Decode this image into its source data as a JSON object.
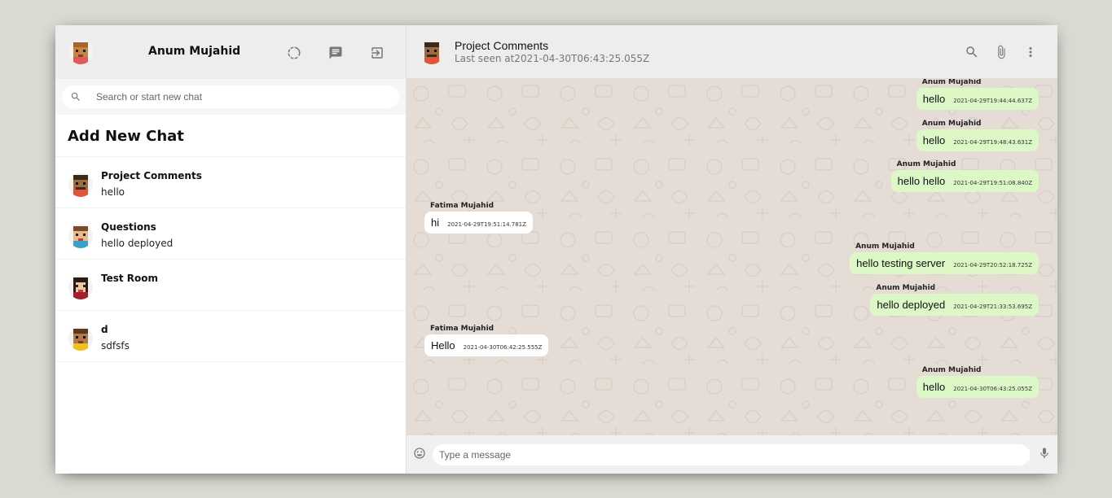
{
  "sidebar": {
    "user_name": "Anum Mujahid",
    "icons": [
      "status-icon",
      "chat-icon",
      "logout-icon"
    ],
    "search": {
      "placeholder": "Search or start new chat",
      "value": ""
    },
    "add_new_chat": "Add New Chat",
    "rooms": [
      {
        "name": "Project Comments",
        "last_message": "hello"
      },
      {
        "name": "Questions",
        "last_message": "hello deployed"
      },
      {
        "name": "Test Room",
        "last_message": ""
      },
      {
        "name": "d",
        "last_message": "sdfsfs"
      }
    ]
  },
  "chat": {
    "room_name": "Project Comments",
    "last_seen": "Last seen at2021-04-30T06:43:25.055Z",
    "icons": [
      "search-icon",
      "attach-icon",
      "more-vert-icon"
    ],
    "messages": [
      {
        "name": "Anum Mujahid",
        "text": "hello",
        "time": "2021-04-29T19:44:44.637Z",
        "sent": true
      },
      {
        "name": "Anum Mujahid",
        "text": "hello",
        "time": "2021-04-29T19:48:43.631Z",
        "sent": true
      },
      {
        "name": "Anum Mujahid",
        "text": "hello hello",
        "time": "2021-04-29T19:51:08.840Z",
        "sent": true
      },
      {
        "name": "Fatima Mujahid",
        "text": "hi",
        "time": "2021-04-29T19:51:14.781Z",
        "sent": false
      },
      {
        "name": "Anum Mujahid",
        "text": "hello testing server",
        "time": "2021-04-29T20:52:18.725Z",
        "sent": true
      },
      {
        "name": "Anum Mujahid",
        "text": "hello deployed",
        "time": "2021-04-29T21:33:53.695Z",
        "sent": true
      },
      {
        "name": "Fatima Mujahid",
        "text": "Hello",
        "time": "2021-04-30T06:42:25.555Z",
        "sent": false
      },
      {
        "name": "Anum Mujahid",
        "text": "hello",
        "time": "2021-04-30T06:43:25.055Z",
        "sent": true
      }
    ],
    "input": {
      "placeholder": "Type a message",
      "value": ""
    }
  },
  "colors": {
    "background": "#dadbd3",
    "header": "#ededed",
    "sent_bubble": "#dcf8c6",
    "received_bubble": "#ffffff",
    "chat_bg": "#e5ddd5"
  }
}
